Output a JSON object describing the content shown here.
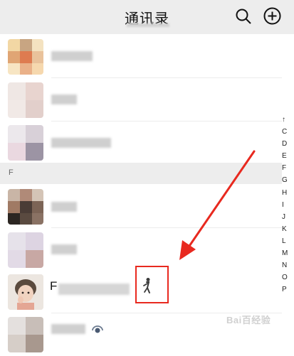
{
  "header": {
    "title": "通讯录"
  },
  "section": {
    "letter": "F"
  },
  "index_letters": [
    "↑",
    "C",
    "D",
    "E",
    "F",
    "G",
    "H",
    "I",
    "J",
    "K",
    "L",
    "M",
    "N",
    "O",
    "P"
  ],
  "contact": {
    "initial": "F"
  },
  "watermark": {
    "text": "Bai百经验"
  },
  "colors": {
    "highlight": "#e8291f",
    "header_bg": "#ededed"
  },
  "icons": [
    "search-icon",
    "add-icon",
    "sticker-icon",
    "status-icon"
  ]
}
